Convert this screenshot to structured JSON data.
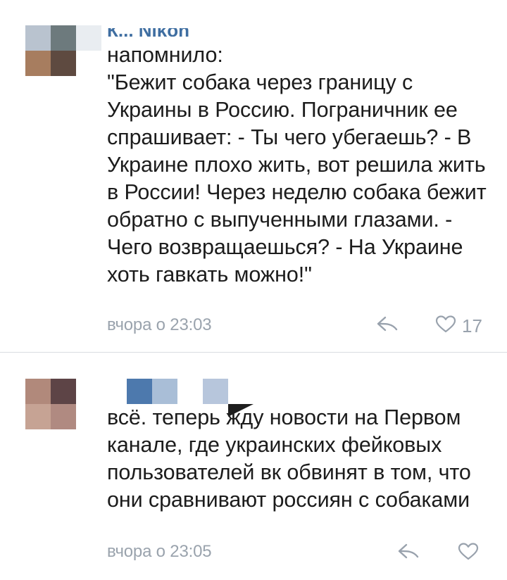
{
  "comments": [
    {
      "author": "К... Nikon",
      "text": "напомнило:\n\"Бежит собака через границу с Украины в Россию. Пограничник ее спрашивает: - Ты чего убегаешь? - В Украине плохо жить, вот решила жить в России! Через неделю собака бежит обратно с выпученными глазами. - Чего возвращаешься? - На Украине хоть гавкать можно!\"",
      "timestamp": "вчора о 23:03",
      "likes": "17",
      "reply_icon": "reply-arrow-icon",
      "like_icon": "heart-icon"
    },
    {
      "author": "",
      "text": "всё. теперь жду новости на Первом канале, где украинских фейковых пользователей вк обвинят в том, что они сравнивают россиян с собаками",
      "timestamp": "вчора о 23:05",
      "likes": "",
      "reply_icon": "reply-arrow-icon",
      "like_icon": "heart-icon"
    }
  ],
  "colors": {
    "author": "#3f6ea1",
    "text": "#1c1c1c",
    "meta": "#9aa3ad",
    "divider": "#d9dde2"
  }
}
